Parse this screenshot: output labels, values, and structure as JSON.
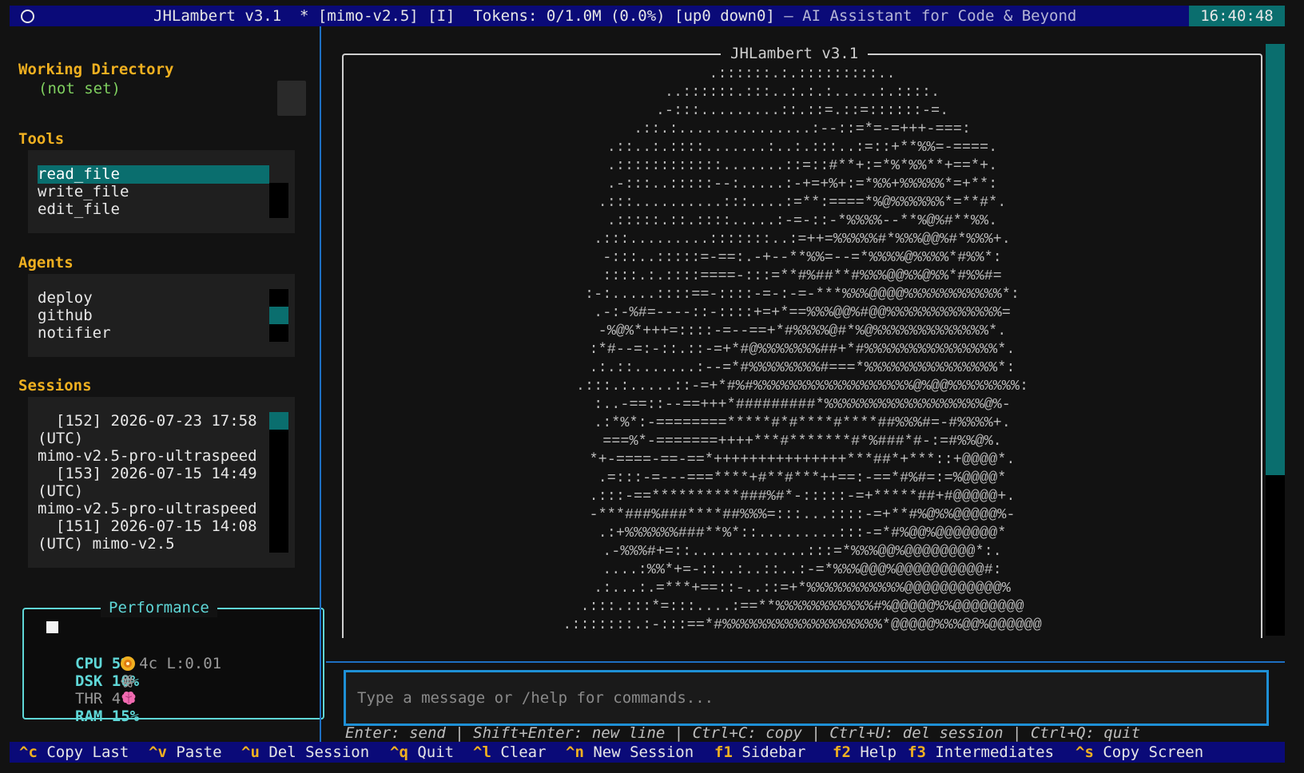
{
  "titlebar": {
    "title": "JHLambert v3.1  * [mimo-v2.5] [I]  Tokens: 0/1.0M (0.0%) [up0 down0]",
    "subtitle": " – AI Assistant for Code & Beyond",
    "clock": "16:40:48"
  },
  "sidebar": {
    "working_directory": {
      "title": "Working Directory",
      "value": "(not set)"
    },
    "tools": {
      "title": "Tools",
      "items": [
        "read_file",
        "write_file",
        "edit_file"
      ],
      "selected_index": 0
    },
    "agents": {
      "title": "Agents",
      "items": [
        "deploy",
        "github",
        "notifier"
      ]
    },
    "sessions": {
      "title": "Sessions",
      "lines": [
        "  [152] 2026-07-23 17:58",
        "(UTC)",
        "mimo-v2.5-pro-ultraspeed",
        "  [153] 2026-07-15 14:49",
        "(UTC)",
        "mimo-v2.5-pro-ultraspeed",
        "  [151] 2026-07-15 14:08",
        "(UTC) mimo-v2.5"
      ]
    },
    "performance": {
      "title": "Performance",
      "cpu": {
        "icon": "cpu-icon",
        "label": "CPU",
        "value": "5%",
        "extra": "4c L:0.01"
      },
      "dsk": {
        "icon": "disk-icon",
        "label": "DSK",
        "value": "10%"
      },
      "thr": {
        "icon": "threads-icon",
        "label": "THR",
        "value": "4"
      },
      "ram": {
        "icon": "brain-icon",
        "label": "RAM",
        "value": "15%"
      }
    }
  },
  "main": {
    "frame_title": "JHLambert v3.1",
    "ascii_lines": [
      ".::::::.:.:::::::::..",
      "..::::::.:::..:.:.:.....:.::::.",
      ".-:::.........::.::=.::=::::::-=.",
      ".::.:...............:--::=*=-=+++-===:",
      ".::..:.::::.......:..:.:::..:=::+**%%=-====.",
      ".::::::::::::.......::=::#**+:=*%*%%**+==*+.",
      ".-:::..:::::--:.....:-+=+%+:=*%%+%%%%%*=+**:",
      ".:::..........:::....:=**:====*%@%%%%%%*=**#*.",
      ".:::::.::.::::.....:-=-::-*%%%%--**%@%#**%%.",
      ".:::.........:::::::..:=++=%%%%%#*%%%@@%#*%%%+.",
      "-:::..:::::=-==:.-+--**%%=--=*%%%%@%%%%*#%%*:",
      "::::.:.::::====-:::=**#%##**#%%%@@%%@%%*#%%#=",
      ":-:.....::::==-::::-=-:-=-***%%%@@@@%%%%%%%%%%%*:",
      ".-:-%#=----::-::::+=+*==%%%@@%#@@%%%%%%%%%%%%%=",
      "-%@%*+++=::::-=--==+*#%%%%@#*%@%%%%%%%%%%%%%*.",
      ":*#--=:-::.::-=+*#@%%%%%%%##+*#%%%%%%%%%%%%%%%*.",
      ".:.::.......:--=*#%%%%%%%%#===*%%%%%%%%%%%%%%%*:",
      ".:::.:.....::-=+*#%#%%%%%%%%%%%%%%%%%%@%@@%%%%%%%%:",
      ":..-==::--==+++*#########*%%%%%%%%%%%%%%%%%%@%-",
      ".:*%*:-========*****#*#****#****##%%%#=-#%%%%+.",
      "===%*-=======++++***#*******#*%###*#-:=#%%@%.",
      "*+-====-==-==*+++++++++++++++***##*+***::+@@@@*.",
      ".=:::-=---===****+#**#***++==:-==*#%#=:=%@@@@*",
      ".:::-==**********###%#*-:::::-=+*****##+#@@@@@+.",
      "-***###%###****##%%%=:::...::::-=+**#%@%%@@@@@%-",
      ".:+%%%%%%###**%*::.........:::-=*#%@@%@@@@@@@*",
      ".-%%%#+=::.............:::=*%%%@@%@@@@@@@@*:.",
      "....:%%*+=-::..:..::..:-=*%%%@@@%@@@@@@@@@@#:",
      ".:...:.=***+==::-..::=+*%%%%%%%%%%%@@@@@@@@@@@%",
      ".:::.:::*=:::....:==**%%%%%%%%%%%#%@@@@@%%@@@@@@@@",
      ".:::::::.:-:::==*#%%%%%%%%%%%%%%%%%%*@@@@@%%%@@%@@@@@@"
    ],
    "input": {
      "placeholder": "Type a message or /help for commands...",
      "value": ""
    },
    "hint": "Enter: send | Shift+Enter: new line | Ctrl+C: copy | Ctrl+U: del session | Ctrl+Q: quit"
  },
  "keybar": [
    {
      "key": "^c",
      "label": "Copy Last"
    },
    {
      "key": "^v",
      "label": "Paste"
    },
    {
      "key": "^u",
      "label": "Del Session"
    },
    {
      "key": "^q",
      "label": "Quit"
    },
    {
      "key": "^l",
      "label": "Clear"
    },
    {
      "key": "^n",
      "label": "New Session"
    },
    {
      "key": "f1",
      "label": "Sidebar"
    },
    {
      "key": "f2",
      "label": "Help"
    },
    {
      "key": "f3",
      "label": "Intermediates"
    },
    {
      "key": "^s",
      "label": "Copy Screen"
    }
  ],
  "colors": {
    "accent_yellow": "#f0b020",
    "accent_cyan": "#5fd7d7",
    "selection_teal": "#0a6e6e",
    "bar_blue": "#0a0a78",
    "working_dir_green": "#7fcf5f"
  }
}
